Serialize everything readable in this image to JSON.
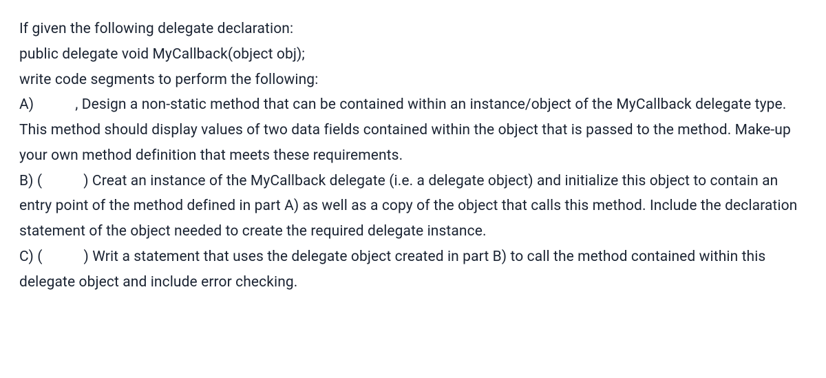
{
  "question": {
    "intro_line1": "If given the following delegate declaration:",
    "intro_line2": "public delegate void MyCallback(object obj);",
    "intro_line3": "write code segments to perform the following:",
    "partA_label": "A)",
    "partA_text": ", Design a non-static method that can be contained within an instance/object of the MyCallback delegate type. This method should display values of two data fields contained within the object that is passed to the method. Make-up your own method definition that meets these requirements.",
    "partB_label": "B) (",
    "partB_close": ")",
    "partB_text": " Creat an instance of the MyCallback delegate (i.e. a delegate object) and initialize this object to contain an entry point of the method defined in part A) as well as a copy of the object that calls this method. Include the declaration statement of the object needed to create the required delegate instance.",
    "partC_label": "C) (",
    "partC_close": ")",
    "partC_text": " Writ a statement that uses the delegate object created in part B) to call the method contained within this delegate object and include error checking."
  }
}
